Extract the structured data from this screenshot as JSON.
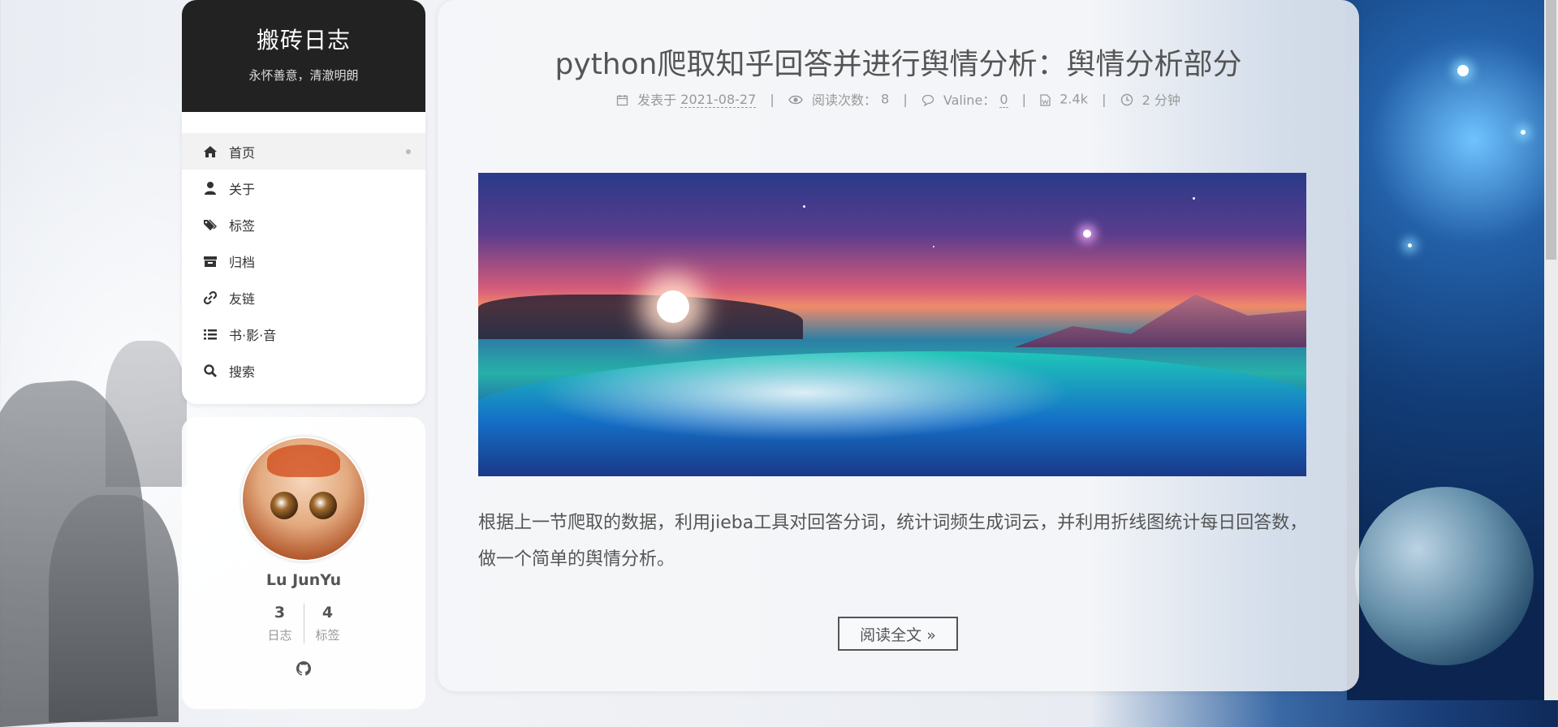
{
  "site": {
    "title": "搬砖日志",
    "subtitle": "永怀善意，清澈明朗"
  },
  "menu": {
    "items": [
      {
        "label": "首页",
        "icon": "home-icon",
        "active": true
      },
      {
        "label": "关于",
        "icon": "user-icon"
      },
      {
        "label": "标签",
        "icon": "tags-icon"
      },
      {
        "label": "归档",
        "icon": "archive-icon"
      },
      {
        "label": "友链",
        "icon": "link-icon"
      },
      {
        "label": "书·影·音",
        "icon": "list-icon"
      },
      {
        "label": "搜索",
        "icon": "search-icon"
      }
    ]
  },
  "profile": {
    "name": "Lu JunYu",
    "stats": [
      {
        "count": "3",
        "label": "日志"
      },
      {
        "count": "4",
        "label": "标签"
      }
    ],
    "social_icon": "github-icon"
  },
  "post": {
    "title": "python爬取知乎回答并进行舆情分析：舆情分析部分",
    "meta": {
      "posted_label": "发表于",
      "posted_date": "2021-08-27",
      "views_label": "阅读次数：",
      "views_count": "8",
      "comments_label": "Valine：",
      "comments_count": "0",
      "word_count": "2.4k",
      "read_time": "2 分钟"
    },
    "excerpt": "根据上一节爬取的数据，利用jieba工具对回答分词，统计词频生成词云，并利用折线图统计每日回答数，做一个简单的舆情分析。",
    "read_more": "阅读全文 »"
  },
  "colors": {
    "sidebar_header_bg": "#222222",
    "text": "#555555",
    "muted": "#999999"
  }
}
